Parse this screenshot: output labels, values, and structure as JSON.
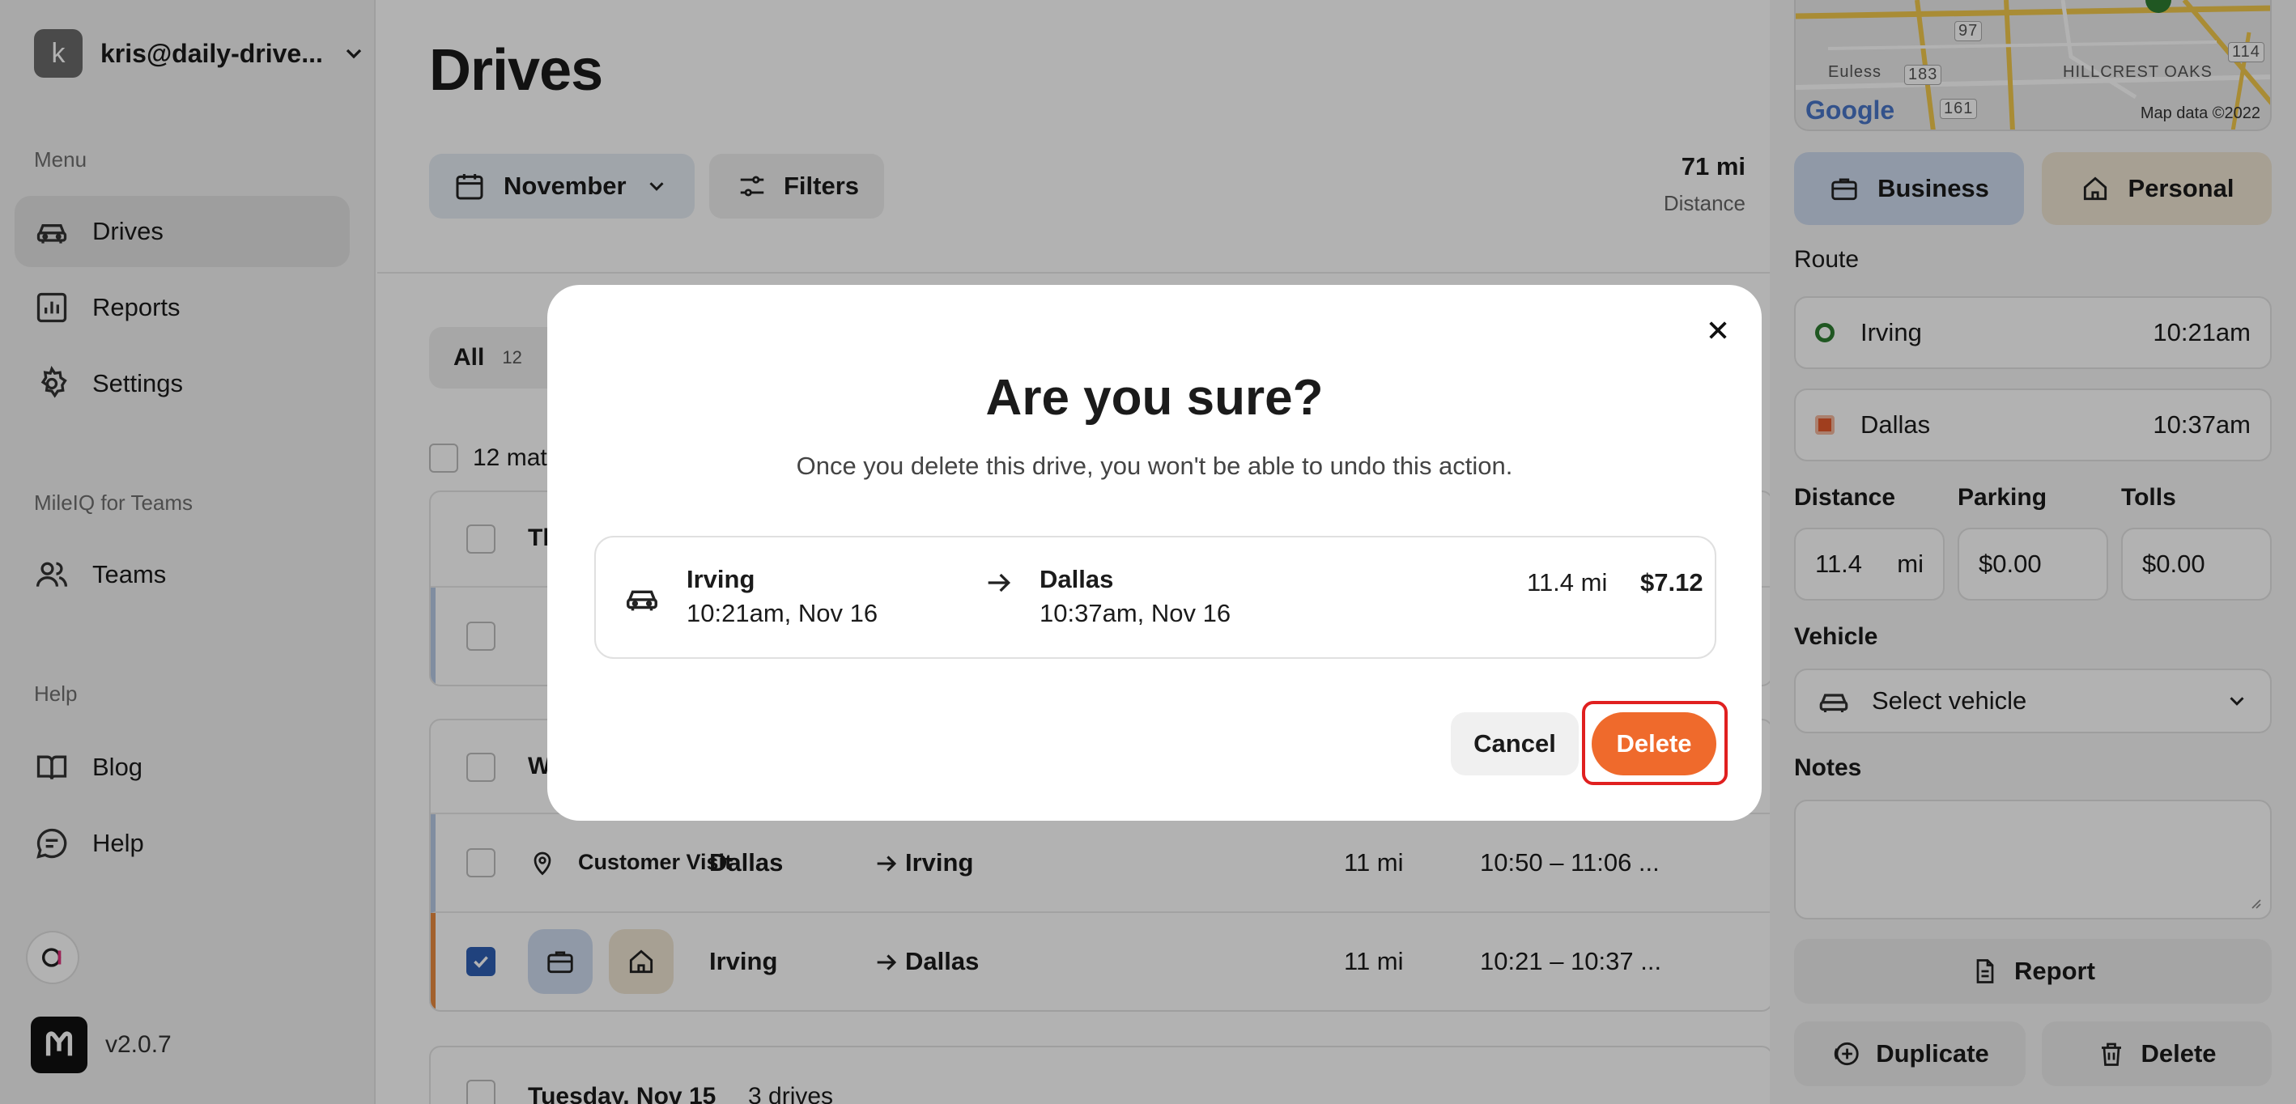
{
  "sidebar": {
    "account": {
      "initial": "k",
      "email": "kris@daily-drive..."
    },
    "menu_title": "Menu",
    "menu_items": [
      {
        "label": "Drives",
        "icon": "car-icon"
      },
      {
        "label": "Reports",
        "icon": "bar-chart-icon"
      },
      {
        "label": "Settings",
        "icon": "gear-icon"
      }
    ],
    "teams_title": "MileIQ for Teams",
    "teams_items": [
      {
        "label": "Teams",
        "icon": "users-icon"
      }
    ],
    "help_title": "Help",
    "help_items": [
      {
        "label": "Blog",
        "icon": "book-icon"
      },
      {
        "label": "Help",
        "icon": "chat-icon"
      }
    ],
    "version": "v2.0.7"
  },
  "main": {
    "title": "Drives",
    "month_button": "November",
    "filters_button": "Filters",
    "stat_value": "71 mi",
    "stat_label": "Distance",
    "tab_all": "All",
    "tab_all_count": "12",
    "select_text": "12 mat",
    "group1_header": "Th",
    "group2_header": "W",
    "rows": [
      {
        "purpose": "Customer Visit",
        "from": "Dallas",
        "to": "Irving",
        "distance": "11 mi",
        "time": "10:50 – 11:06 ..."
      },
      {
        "from": "Irving",
        "to": "Dallas",
        "distance": "11 mi",
        "time": "10:21 – 10:37 ..."
      }
    ],
    "group3_header": "Tuesday, Nov 15",
    "group3_count": "3 drives"
  },
  "panel": {
    "map": {
      "city1": "Euless",
      "city2": "HILLCREST OAKS",
      "road1": "97",
      "road2": "183",
      "road3": "161",
      "road4": "114",
      "logo": "Google",
      "credit": "Map data ©2022"
    },
    "business_label": "Business",
    "personal_label": "Personal",
    "route_label": "Route",
    "route_start": {
      "name": "Irving",
      "time": "10:21am"
    },
    "route_end": {
      "name": "Dallas",
      "time": "10:37am"
    },
    "distance_label": "Distance",
    "parking_label": "Parking",
    "tolls_label": "Tolls",
    "distance_value": "11.4",
    "distance_unit": "mi",
    "parking_value": "$0.00",
    "tolls_value": "$0.00",
    "vehicle_label": "Vehicle",
    "vehicle_placeholder": "Select vehicle",
    "notes_label": "Notes",
    "report_button": "Report",
    "duplicate_button": "Duplicate",
    "delete_button": "Delete"
  },
  "modal": {
    "title": "Are you sure?",
    "message": "Once you delete this drive, you won't be able to undo this action.",
    "drive": {
      "from": "Irving",
      "from_time": "10:21am, Nov 16",
      "to": "Dallas",
      "to_time": "10:37am, Nov 16",
      "distance": "11.4 mi",
      "amount": "$7.12"
    },
    "cancel_label": "Cancel",
    "delete_label": "Delete"
  },
  "colors": {
    "accent_orange": "#ef6a2c",
    "business_blue": "#cfdcef",
    "personal_tan": "#efe5d3",
    "highlight_red": "#e02020"
  }
}
